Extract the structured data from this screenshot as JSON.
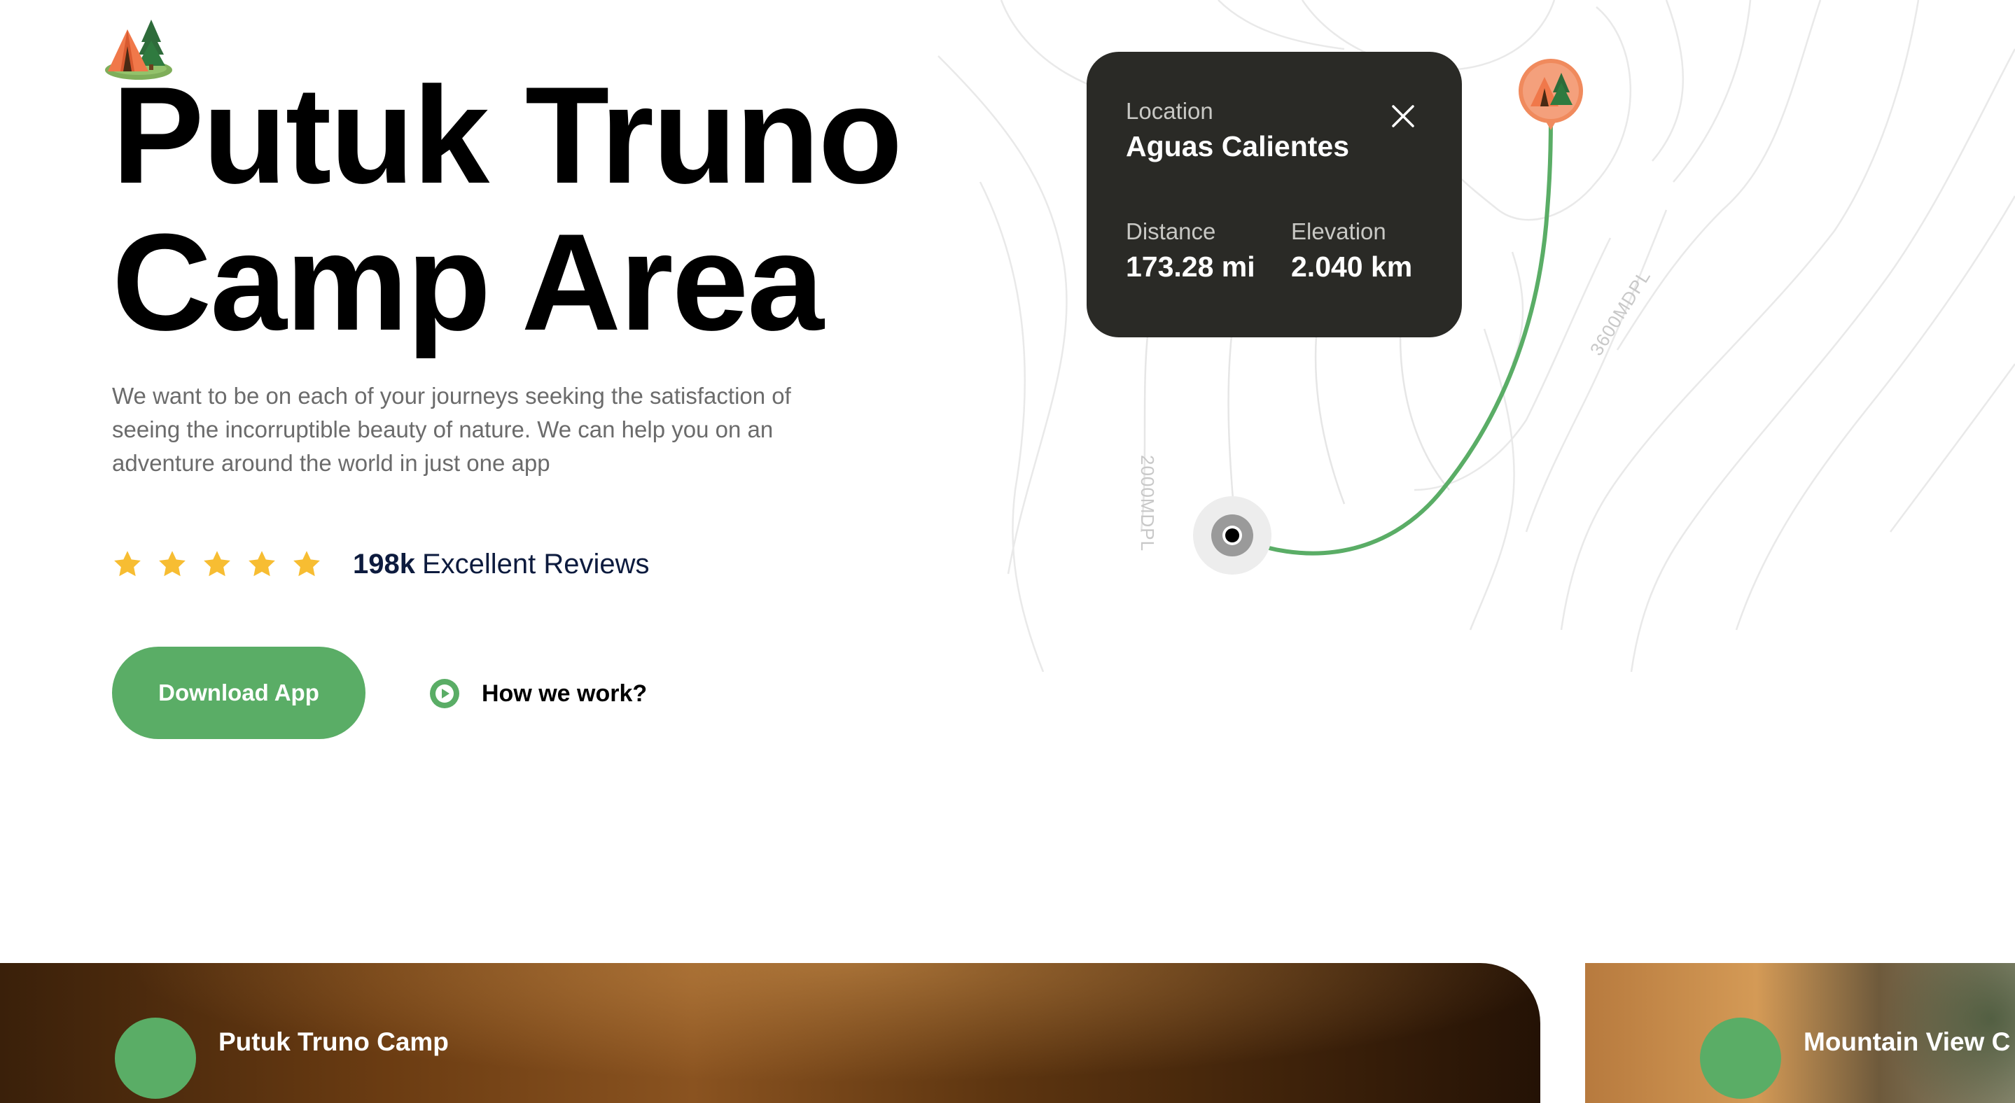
{
  "hero": {
    "title_line1": "Putuk Truno",
    "title_line2": "Camp Area",
    "subtitle": "We want to be on each of your journeys seeking the satisfaction of seeing the incorruptible beauty of nature. We can help you on an adventure around the world in just one app",
    "logo_icon": "camping-tent-icon"
  },
  "rating": {
    "stars": 5,
    "star_icon": "star-icon",
    "count": "198k",
    "label": "Excellent Reviews",
    "star_color": "#f7bd32"
  },
  "actions": {
    "download_label": "Download App",
    "how_label": "How we work?",
    "play_icon": "play-circle-icon"
  },
  "map": {
    "card": {
      "location_label": "Location",
      "location_value": "Aguas Calientes",
      "distance_label": "Distance",
      "distance_value": "173.28 mi",
      "elevation_label": "Elevation",
      "elevation_value": "2.040 km",
      "close_icon": "close-icon"
    },
    "contour_labels": [
      "2000MDPL",
      "3600MDPL"
    ],
    "start_marker_icon": "location-dot-icon",
    "end_marker_icon": "camp-pin-icon"
  },
  "cards": [
    {
      "title": "Putuk Truno Camp"
    },
    {
      "title": "Mountain View C"
    }
  ],
  "colors": {
    "accent": "#5aad66",
    "card_dark": "#2a2a26",
    "pin": "#f08a5d",
    "text_muted": "#6b6b6b",
    "heading_navy": "#0d1b3e"
  }
}
